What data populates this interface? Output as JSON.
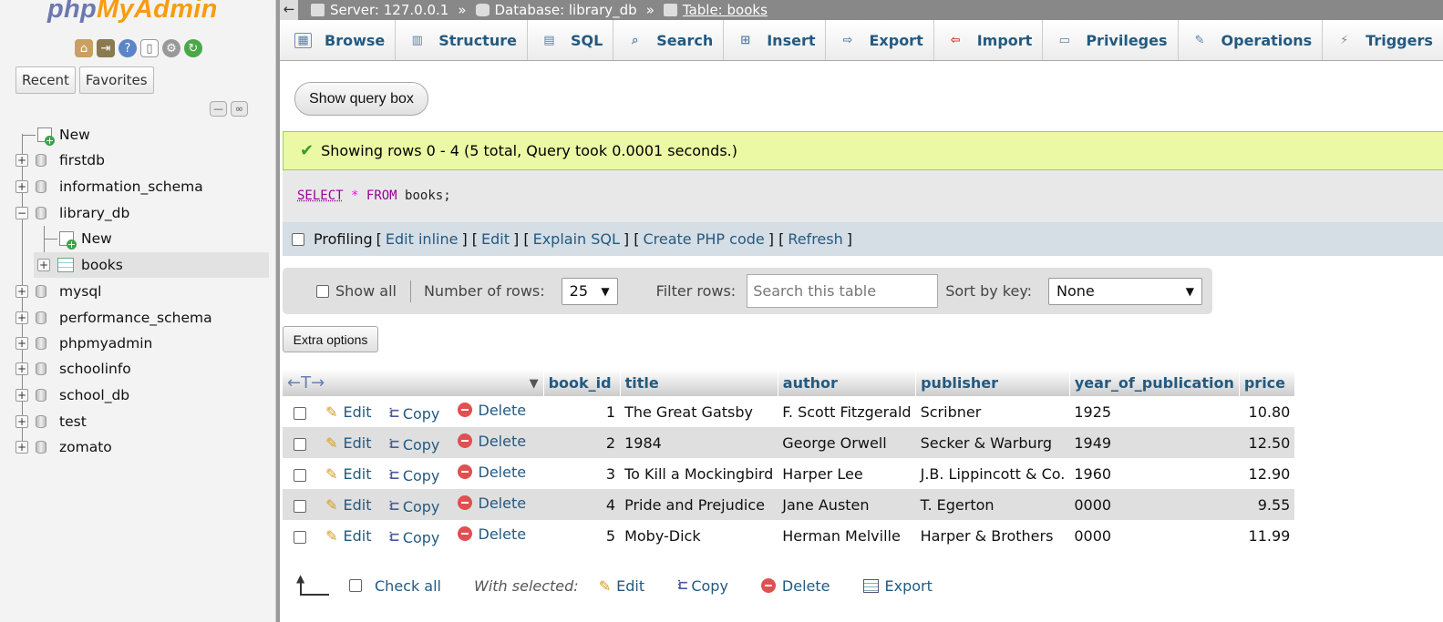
{
  "nav": {
    "logo_php": "php",
    "logo_myadmin": "MyAdmin",
    "quick_icons": [
      "home-icon",
      "logout-icon",
      "help-icon",
      "docs-icon",
      "settings-icon",
      "reload-icon"
    ],
    "tabs": [
      "Recent",
      "Favorites"
    ],
    "tree": [
      {
        "label": "New",
        "type": "new",
        "level": 0
      },
      {
        "label": "firstdb",
        "type": "db",
        "level": 0
      },
      {
        "label": "information_schema",
        "type": "db",
        "level": 0
      },
      {
        "label": "library_db",
        "type": "db",
        "level": 0,
        "expanded": true
      },
      {
        "label": "New",
        "type": "new",
        "level": 1
      },
      {
        "label": "books",
        "type": "table",
        "level": 1,
        "selected": true
      },
      {
        "label": "mysql",
        "type": "db",
        "level": 0
      },
      {
        "label": "performance_schema",
        "type": "db",
        "level": 0
      },
      {
        "label": "phpmyadmin",
        "type": "db",
        "level": 0
      },
      {
        "label": "schoolinfo",
        "type": "db",
        "level": 0
      },
      {
        "label": "school_db",
        "type": "db",
        "level": 0
      },
      {
        "label": "test",
        "type": "db",
        "level": 0
      },
      {
        "label": "zomato",
        "type": "db",
        "level": 0
      }
    ]
  },
  "breadcrumb": {
    "server": "Server: 127.0.0.1",
    "database": "Database: library_db",
    "table": "Table: books",
    "separator": "»"
  },
  "menu": [
    "Browse",
    "Structure",
    "SQL",
    "Search",
    "Insert",
    "Export",
    "Import",
    "Privileges",
    "Operations",
    "Triggers"
  ],
  "query": {
    "show_query_box": "Show query box",
    "success_message": "Showing rows 0 - 4 (5 total, Query took 0.0001 seconds.)",
    "sql_select": "SELECT",
    "sql_star": "*",
    "sql_from": "FROM",
    "sql_table": "books;"
  },
  "profiling": {
    "label": "Profiling",
    "links": [
      "Edit inline",
      "Edit",
      "Explain SQL",
      "Create PHP code",
      "Refresh"
    ]
  },
  "navbar": {
    "show_all": "Show all",
    "rows_label": "Number of rows:",
    "rows_value": "25",
    "filter_label": "Filter rows:",
    "filter_placeholder": "Search this table",
    "sort_label": "Sort by key:",
    "sort_value": "None"
  },
  "extra_options": "Extra options",
  "table": {
    "columns": [
      "book_id",
      "title",
      "author",
      "publisher",
      "year_of_publication",
      "price"
    ],
    "action_labels": {
      "edit": "Edit",
      "copy": "Copy",
      "delete": "Delete"
    },
    "rows": [
      {
        "book_id": "1",
        "title": "The Great Gatsby",
        "author": "F. Scott Fitzgerald",
        "publisher": "Scribner",
        "year": "1925",
        "price": "10.80"
      },
      {
        "book_id": "2",
        "title": "1984",
        "author": "George Orwell",
        "publisher": "Secker & Warburg",
        "year": "1949",
        "price": "12.50"
      },
      {
        "book_id": "3",
        "title": "To Kill a Mockingbird",
        "author": "Harper Lee",
        "publisher": "J.B. Lippincott & Co.",
        "year": "1960",
        "price": "12.90"
      },
      {
        "book_id": "4",
        "title": "Pride and Prejudice",
        "author": "Jane Austen",
        "publisher": "T. Egerton",
        "year": "0000",
        "price": "9.55"
      },
      {
        "book_id": "5",
        "title": "Moby-Dick",
        "author": "Herman Melville",
        "publisher": "Harper & Brothers",
        "year": "0000",
        "price": "11.99"
      }
    ]
  },
  "bottom": {
    "check_all": "Check all",
    "with_selected": "With selected:",
    "edit": "Edit",
    "copy": "Copy",
    "delete": "Delete",
    "export": "Export"
  },
  "colors": {
    "link": "#235a81",
    "success_bg": "#ebf8a4",
    "logo_php": "#6c78af",
    "logo_myadmin": "#f89c0e"
  }
}
